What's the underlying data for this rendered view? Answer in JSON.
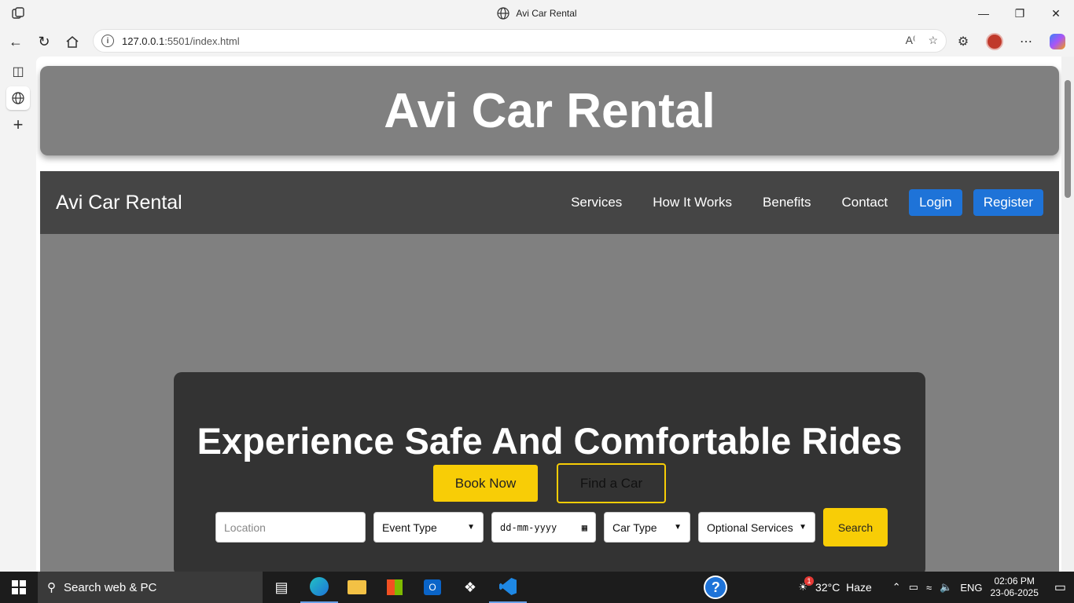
{
  "browser": {
    "tab_title": "Avi Car Rental",
    "url_host": "127.0.0.1",
    "url_rest": ":5501/index.html"
  },
  "page": {
    "banner_title": "Avi Car Rental",
    "brand": "Avi Car Rental",
    "nav": [
      "Services",
      "How It Works",
      "Benefits",
      "Contact"
    ],
    "login": "Login",
    "register": "Register",
    "hero_title": "Experience Safe And Comfortable Rides",
    "book_now": "Book Now",
    "find_car": "Find a Car",
    "search": {
      "location_placeholder": "Location",
      "event_type": "Event Type",
      "date_placeholder": "dd-mm-yyyy",
      "car_type": "Car Type",
      "optional_services": "Optional Services",
      "button": "Search"
    },
    "colors": {
      "accent_yellow": "#f8cd06",
      "accent_blue": "#1e73d8",
      "banner_gray": "#808080",
      "nav_dark": "#454545"
    }
  },
  "taskbar": {
    "search_placeholder": "Search web & PC",
    "weather": "32°C  Haze",
    "weather_badge": "1",
    "lang": "ENG",
    "time": "02:06 PM",
    "date": "23-06-2025"
  }
}
